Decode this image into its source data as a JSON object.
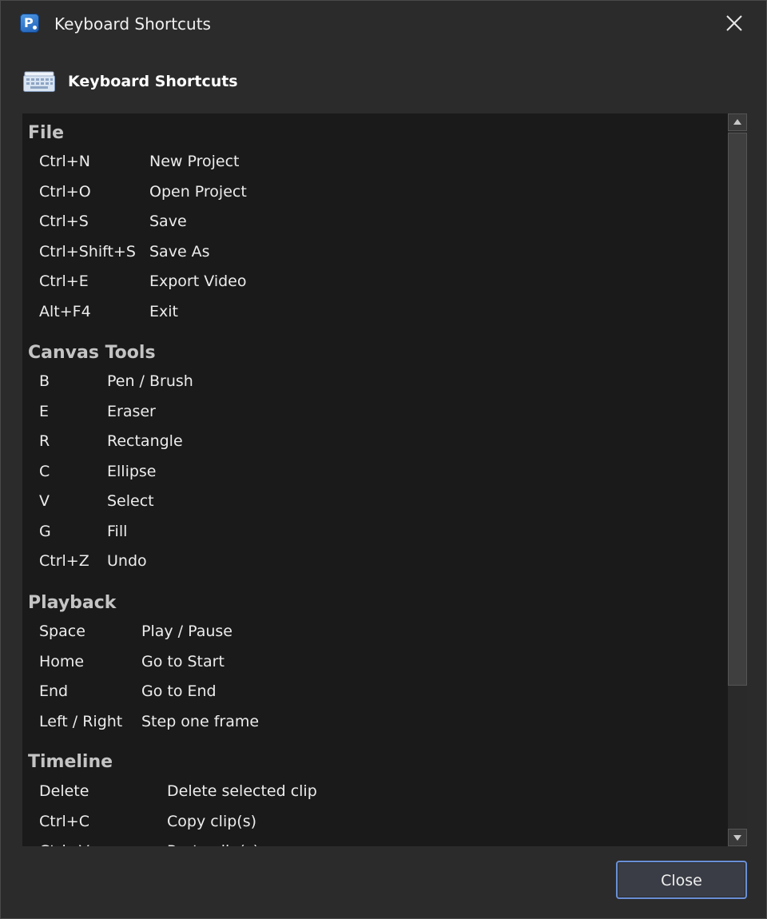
{
  "window": {
    "title": "Keyboard Shortcuts",
    "app_icon_letter": "P"
  },
  "header": {
    "title": "Keyboard Shortcuts"
  },
  "sections": {
    "file": {
      "title": "File",
      "rows": [
        {
          "key": "Ctrl+N",
          "action": "New Project"
        },
        {
          "key": "Ctrl+O",
          "action": "Open Project"
        },
        {
          "key": "Ctrl+S",
          "action": "Save"
        },
        {
          "key": "Ctrl+Shift+S",
          "action": "Save As"
        },
        {
          "key": "Ctrl+E",
          "action": "Export Video"
        },
        {
          "key": "Alt+F4",
          "action": "Exit"
        }
      ]
    },
    "canvas_tools": {
      "title": "Canvas Tools",
      "rows": [
        {
          "key": "B",
          "action": "Pen / Brush"
        },
        {
          "key": "E",
          "action": "Eraser"
        },
        {
          "key": "R",
          "action": "Rectangle"
        },
        {
          "key": "C",
          "action": "Ellipse"
        },
        {
          "key": "V",
          "action": "Select"
        },
        {
          "key": "G",
          "action": "Fill"
        },
        {
          "key": "Ctrl+Z",
          "action": "Undo"
        }
      ]
    },
    "playback": {
      "title": "Playback",
      "rows": [
        {
          "key": "Space",
          "action": "Play / Pause"
        },
        {
          "key": "Home",
          "action": "Go to Start"
        },
        {
          "key": "End",
          "action": "Go to End"
        },
        {
          "key": "Left / Right",
          "action": "Step one frame"
        }
      ]
    },
    "timeline": {
      "title": "Timeline",
      "rows": [
        {
          "key": "Delete",
          "action": "Delete selected clip"
        },
        {
          "key": "Ctrl+C",
          "action": "Copy clip(s)"
        },
        {
          "key": "Ctrl+V",
          "action": "Paste clip(s)"
        }
      ]
    }
  },
  "footer": {
    "close_label": "Close"
  },
  "colors": {
    "background": "#2b2b2b",
    "list_background": "#1a1a1a",
    "section_title": "#c4c4c4",
    "row_text": "#ececec",
    "button_focus_border": "#6a8fd6"
  },
  "icons": {
    "app": "app-logo-icon",
    "close": "close-icon",
    "header": "keyboard-icon",
    "scroll_up": "scroll-up-arrow-icon",
    "scroll_down": "scroll-down-arrow-icon"
  }
}
